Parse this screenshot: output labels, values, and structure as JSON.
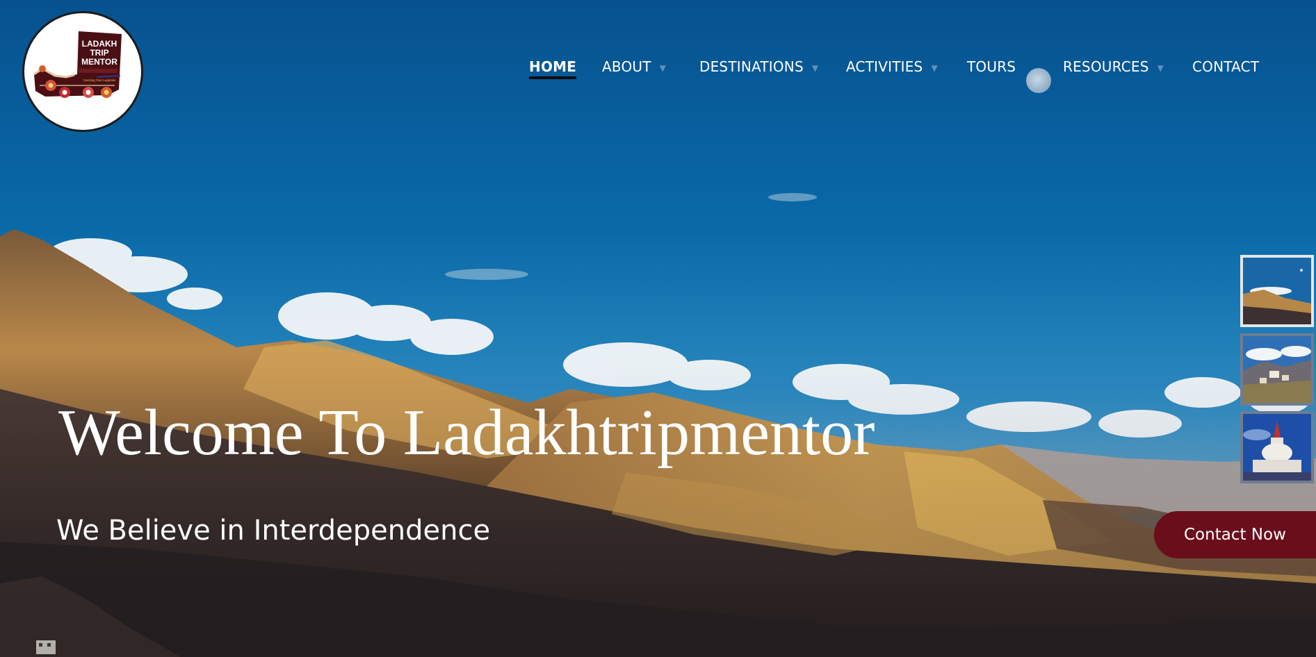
{
  "logo": {
    "line1": "LADAKH",
    "line2": "TRIP",
    "line3": "MENTOR",
    "tagline": "Carrying Your Legacies"
  },
  "nav": {
    "items": [
      {
        "label": "HOME",
        "active": true,
        "has_dropdown": false
      },
      {
        "label": "ABOUT",
        "has_dropdown": true
      },
      {
        "label": "DESTINATIONS",
        "has_dropdown": true
      },
      {
        "label": "ACTIVITIES",
        "has_dropdown": true
      },
      {
        "label": "TOURS",
        "has_dropdown": false
      },
      {
        "label": "RESOURCES",
        "has_dropdown": true
      },
      {
        "label": "CONTACT",
        "has_dropdown": false
      }
    ],
    "dropdown_icon": "chevron-down-icon"
  },
  "hero": {
    "title": "Welcome To Ladakhtripmentor",
    "subtitle": "We Believe in Interdependence",
    "cta_label": "Contact Now"
  },
  "slider": {
    "thumbnails": [
      {
        "subject": "mountain-landscape",
        "active": true
      },
      {
        "subject": "monastery-village",
        "active": false
      },
      {
        "subject": "stupa-night",
        "active": false
      }
    ]
  },
  "colors": {
    "cta_background": "#6a0e1c",
    "nav_text": "#ffffff",
    "sky_top": "#0a4f86",
    "logo_boot": "#4a0f14"
  }
}
